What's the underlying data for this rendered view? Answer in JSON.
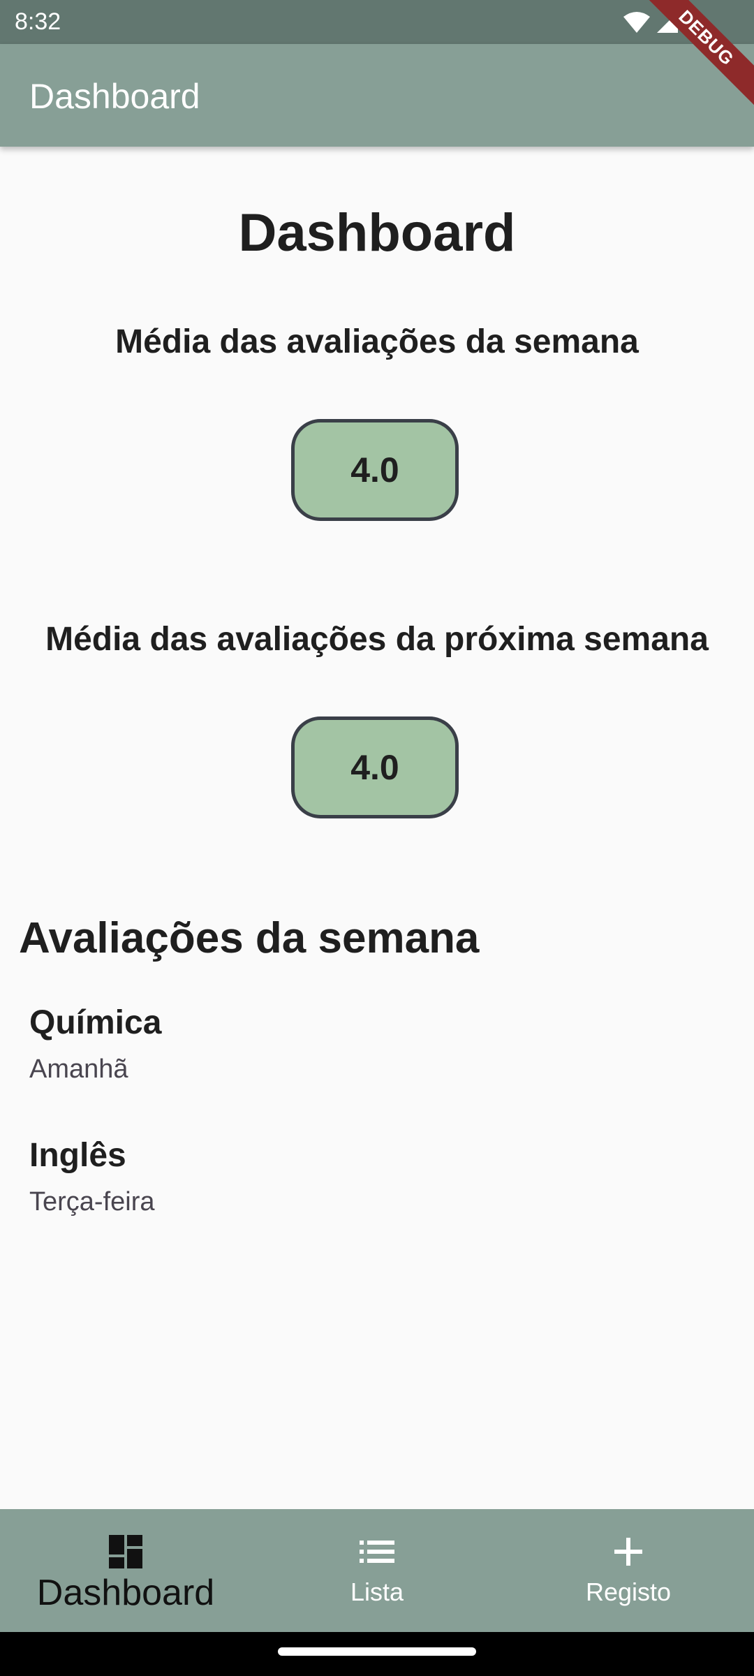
{
  "status_bar": {
    "time": "8:32"
  },
  "debug_banner": "DEBUG",
  "app_bar": {
    "title": "Dashboard"
  },
  "main": {
    "title": "Dashboard",
    "week_average": {
      "label": "Média das avaliações da semana",
      "value": "4.0"
    },
    "next_week_average": {
      "label": "Média das avaliações da próxima semana",
      "value": "4.0"
    },
    "week_evaluations": {
      "title": "Avaliações da semana",
      "items": [
        {
          "subject": "Química",
          "day": "Amanhã"
        },
        {
          "subject": "Inglês",
          "day": "Terça-feira"
        }
      ]
    }
  },
  "bottom_nav": {
    "items": [
      {
        "label": "Dashboard",
        "icon": "dashboard-icon",
        "active": true
      },
      {
        "label": "Lista",
        "icon": "list-icon",
        "active": false
      },
      {
        "label": "Registo",
        "icon": "add-icon",
        "active": false
      }
    ]
  },
  "colors": {
    "status_bar": "#627770",
    "app_bar": "#879f96",
    "average_box": "#a3c4a4",
    "debug_ribbon": "#8e2a2a"
  }
}
